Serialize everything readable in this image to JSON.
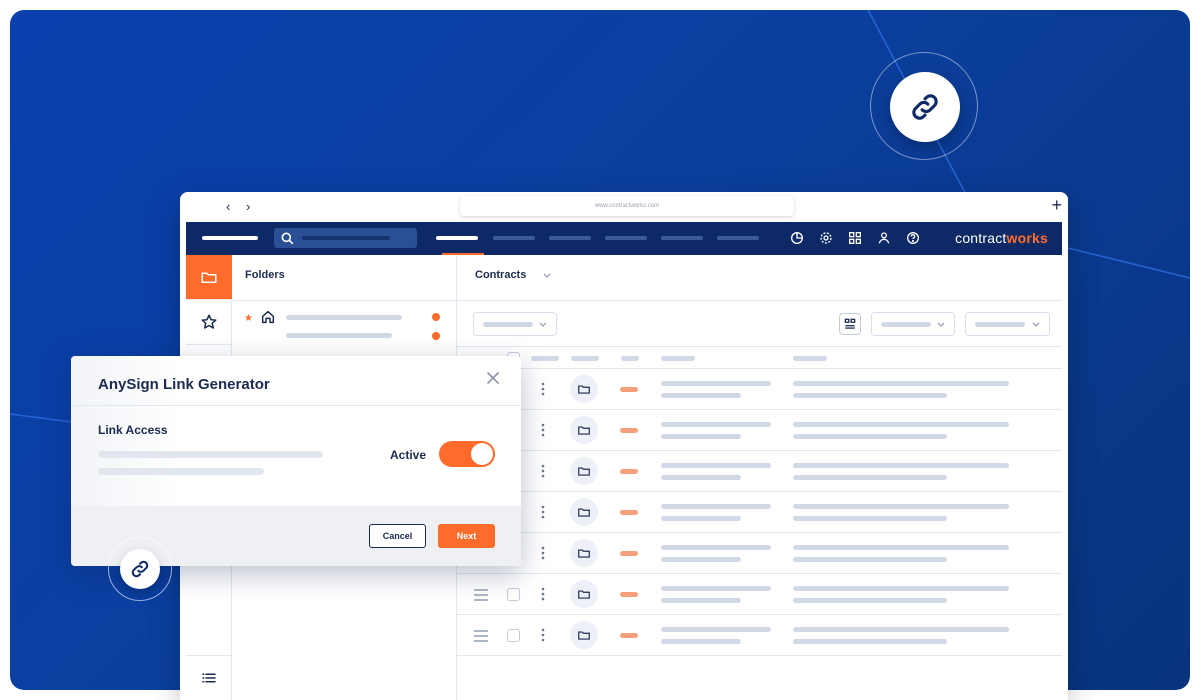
{
  "browser": {
    "nav_arrows": "‹ ›",
    "url": "www.contractworks.com",
    "new_tab": "+"
  },
  "header": {
    "brand_prefix": "contract",
    "brand_suffix": "works"
  },
  "folders": {
    "title": "Folders"
  },
  "contracts": {
    "title": "Contracts"
  },
  "modal": {
    "title": "AnySign Link Generator",
    "close": "×",
    "section_label": "Link Access",
    "toggle_label": "Active",
    "toggle_on": true,
    "cancel_label": "Cancel",
    "next_label": "Next"
  },
  "colors": {
    "background": "#0a3fae",
    "header": "#0d2a66",
    "accent": "#ff6b2b",
    "text": "#1b2a4e"
  },
  "icons": {
    "hero": "link-icon",
    "search": "search-icon",
    "header_icons": [
      "pie-chart-icon",
      "gear-icon",
      "grid-icon",
      "user-icon",
      "help-icon"
    ],
    "rail": [
      "folder-icon",
      "star-icon",
      "list-icon"
    ]
  }
}
